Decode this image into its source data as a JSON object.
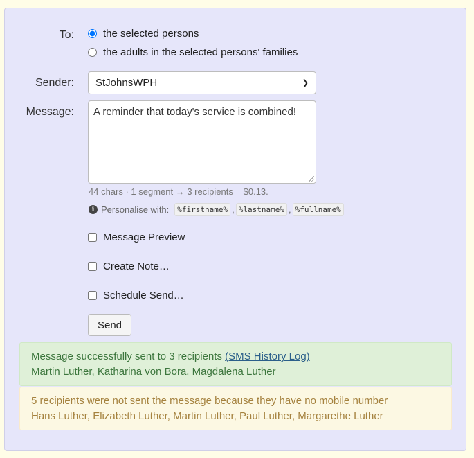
{
  "form": {
    "to_label": "To:",
    "to_options": [
      {
        "label": "the selected persons",
        "checked": true
      },
      {
        "label": "the adults in the selected persons' families",
        "checked": false
      }
    ],
    "sender_label": "Sender:",
    "sender_value": "StJohnsWPH",
    "message_label": "Message:",
    "message_value": "A reminder that today's service is combined!",
    "counter_text": "44 chars · 1 segment → 3 recipients = $0.13.",
    "personalise_label": "Personalise with:",
    "placeholders": [
      "%firstname%",
      "%lastname%",
      "%fullname%"
    ],
    "options": [
      {
        "label": "Message Preview",
        "checked": false
      },
      {
        "label": "Create Note…",
        "checked": false
      },
      {
        "label": "Schedule Send…",
        "checked": false
      }
    ],
    "send_label": "Send"
  },
  "alerts": {
    "success_text": "Message successfully sent to 3 recipients ",
    "success_link": "(SMS History Log)",
    "success_names": "Martin Luther, Katharina von Bora, Magdalena Luther",
    "warning_text": "5 recipients were not sent the message because they have no mobile number",
    "warning_names": "Hans Luther, Elizabeth Luther, Martin Luther, Paul Luther, Margarethe Luther"
  },
  "colors": {
    "panel_bg": "#e6e6fa",
    "page_bg": "#fffde7",
    "success_bg": "#dff0d8",
    "warning_bg": "#fcf8e3"
  },
  "icons": {
    "info": "info-icon",
    "select_chevron": "chevron-down-icon"
  }
}
